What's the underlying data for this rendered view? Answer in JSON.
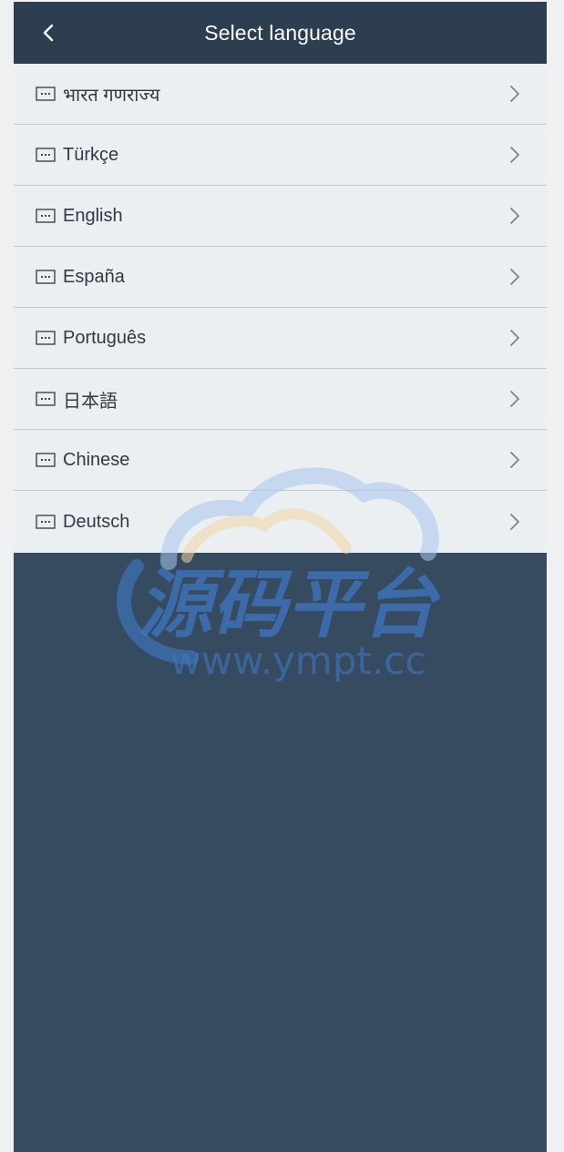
{
  "header": {
    "title": "Select language",
    "back_icon": "chevron-left-icon"
  },
  "languages": [
    {
      "label": "भारत गणराज्य",
      "icon": "keyboard-icon"
    },
    {
      "label": "Türkçe",
      "icon": "keyboard-icon"
    },
    {
      "label": "English",
      "icon": "keyboard-icon"
    },
    {
      "label": "España",
      "icon": "keyboard-icon"
    },
    {
      "label": "Português",
      "icon": "keyboard-icon"
    },
    {
      "label": "日本語",
      "icon": "keyboard-icon"
    },
    {
      "label": "Chinese",
      "icon": "keyboard-icon"
    },
    {
      "label": "Deutsch",
      "icon": "keyboard-icon"
    }
  ],
  "watermark": {
    "logo_text": "源码平台",
    "url_text": "www.ympt.cc"
  },
  "colors": {
    "header_bg": "#2e3e51",
    "body_bg": "#364a60",
    "list_bg": "#ebeff1",
    "divider": "#c6cacd",
    "text": "#2e3a48"
  }
}
